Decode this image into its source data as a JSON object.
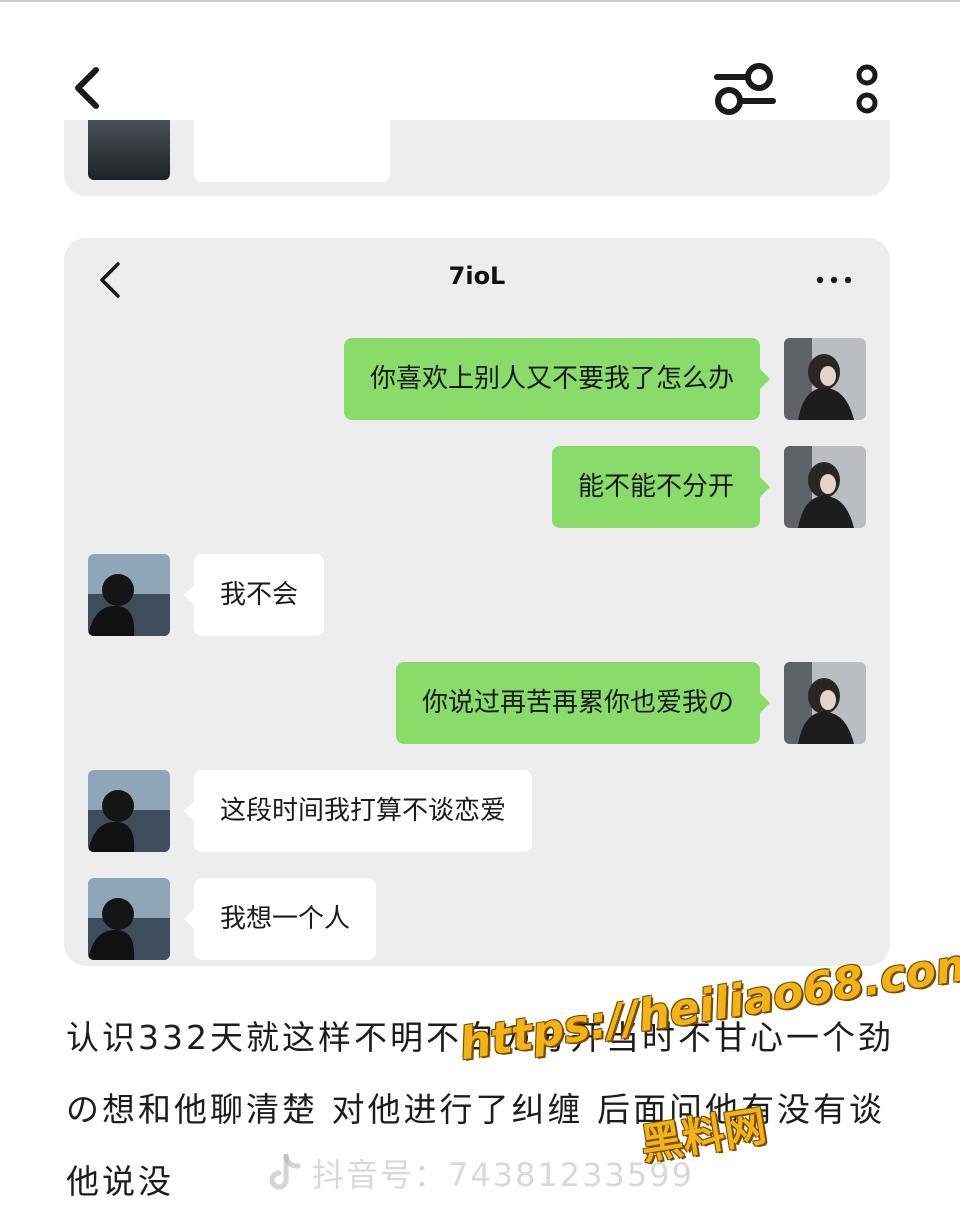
{
  "header": {
    "back_icon": "chevron-left-icon",
    "filter_icon": "sliders-icon",
    "more_icon": "vertical-dots-icon"
  },
  "chat": {
    "title": "7ioL",
    "back_icon": "chevron-left-icon",
    "more_icon": "horizontal-dots-icon",
    "bubble_color_mine": "#89dc6a",
    "bubble_color_theirs": "#ffffff",
    "messages": [
      {
        "sender": "me",
        "text": "你喜欢上别人又不要我了怎么办"
      },
      {
        "sender": "me",
        "text": "能不能不分开"
      },
      {
        "sender": "them",
        "text": "我不会"
      },
      {
        "sender": "me",
        "text": "你说过再苦再累你也爱我の"
      },
      {
        "sender": "them",
        "text": "这段时间我打算不谈恋爱"
      },
      {
        "sender": "them",
        "text": "我想一个人"
      }
    ]
  },
  "caption": {
    "text": "认识332天就这样不明不白の分开当时不甘心一个劲の想和他聊清楚 对他进行了纠缠 后面问他有没有谈 他说没"
  },
  "watermarks": {
    "douyin": "抖音号：74381233599",
    "site_url": "https://heiliao68.com",
    "site_name": "黑料网"
  }
}
